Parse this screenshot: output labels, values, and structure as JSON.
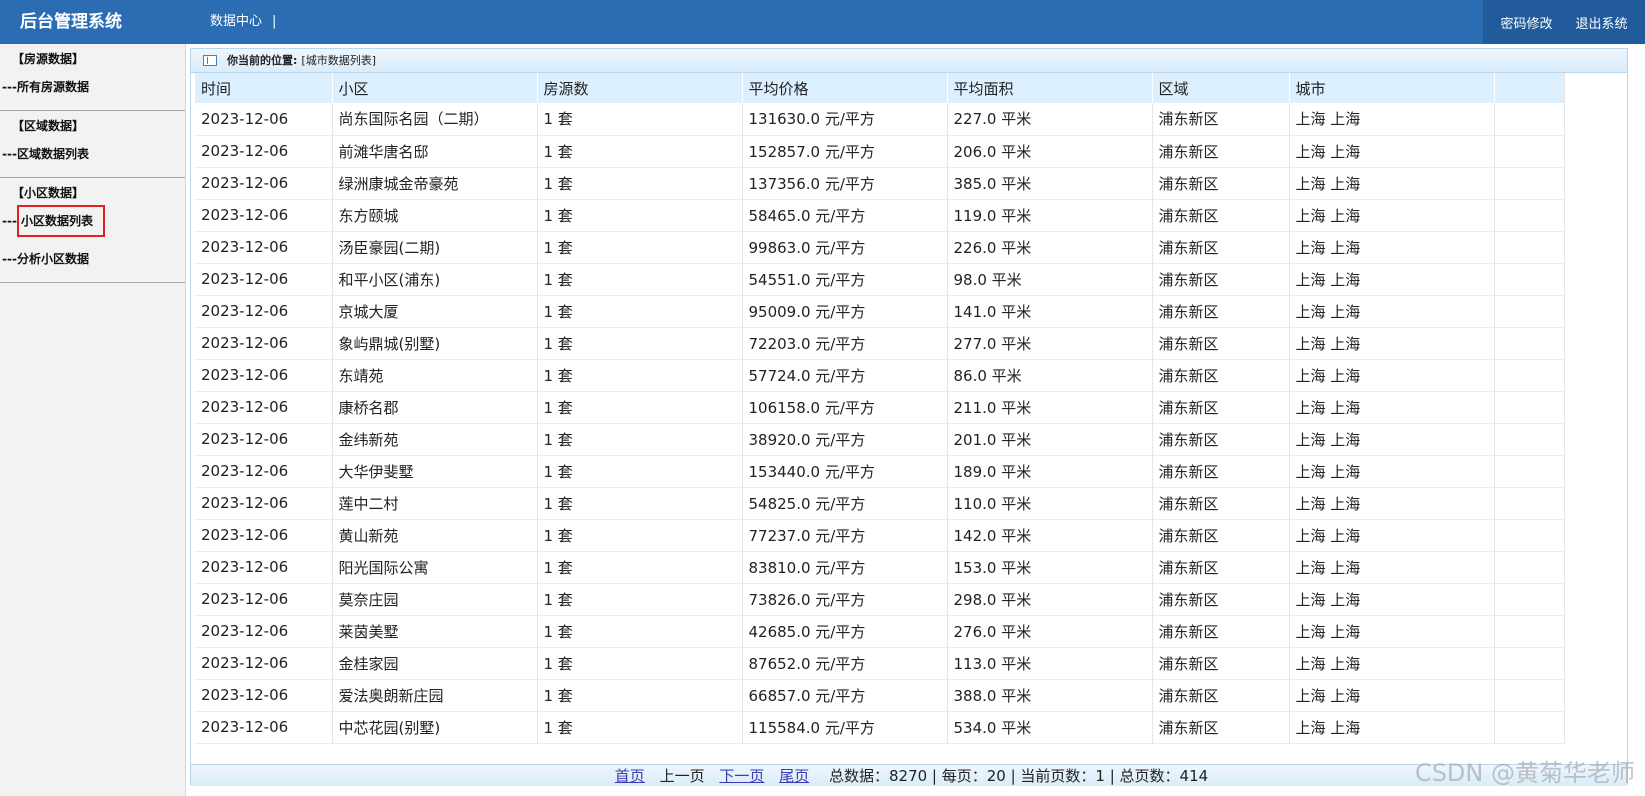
{
  "header": {
    "brand": "后台管理系统",
    "nav_label": "数据中心",
    "nav_sep": "|",
    "change_password": "密码修改",
    "logout": "退出系统"
  },
  "sidebar": {
    "groups": [
      {
        "title": "【房源数据】",
        "items": [
          "---所有房源数据"
        ]
      },
      {
        "title": "【区域数据】",
        "items": [
          "---区域数据列表"
        ]
      },
      {
        "title": "【小区数据】",
        "items": [
          "---",
          "小区数据列表",
          "---分析小区数据"
        ]
      }
    ],
    "active_item": "小区数据列表"
  },
  "location": {
    "label": "你当前的位置:",
    "value": "[城市数据列表]"
  },
  "table": {
    "headers": [
      "时间",
      "小区",
      "房源数",
      "平均价格",
      "平均面积",
      "区域",
      "城市"
    ],
    "rows": [
      [
        "2023-12-06",
        "尚东国际名园（二期）",
        "1 套",
        "131630.0 元/平方",
        "227.0 平米",
        "浦东新区",
        "上海 上海"
      ],
      [
        "2023-12-06",
        "前滩华唐名邸",
        "1 套",
        "152857.0 元/平方",
        "206.0 平米",
        "浦东新区",
        "上海 上海"
      ],
      [
        "2023-12-06",
        "绿洲康城金帝豪苑",
        "1 套",
        "137356.0 元/平方",
        "385.0 平米",
        "浦东新区",
        "上海 上海"
      ],
      [
        "2023-12-06",
        "东方颐城",
        "1 套",
        "58465.0 元/平方",
        "119.0 平米",
        "浦东新区",
        "上海 上海"
      ],
      [
        "2023-12-06",
        "汤臣豪园(二期)",
        "1 套",
        "99863.0 元/平方",
        "226.0 平米",
        "浦东新区",
        "上海 上海"
      ],
      [
        "2023-12-06",
        "和平小区(浦东)",
        "1 套",
        "54551.0 元/平方",
        "98.0 平米",
        "浦东新区",
        "上海 上海"
      ],
      [
        "2023-12-06",
        "京城大厦",
        "1 套",
        "95009.0 元/平方",
        "141.0 平米",
        "浦东新区",
        "上海 上海"
      ],
      [
        "2023-12-06",
        "象屿鼎城(别墅)",
        "1 套",
        "72203.0 元/平方",
        "277.0 平米",
        "浦东新区",
        "上海 上海"
      ],
      [
        "2023-12-06",
        "东靖苑",
        "1 套",
        "57724.0 元/平方",
        "86.0 平米",
        "浦东新区",
        "上海 上海"
      ],
      [
        "2023-12-06",
        "康桥名郡",
        "1 套",
        "106158.0 元/平方",
        "211.0 平米",
        "浦东新区",
        "上海 上海"
      ],
      [
        "2023-12-06",
        "金纬新苑",
        "1 套",
        "38920.0 元/平方",
        "201.0 平米",
        "浦东新区",
        "上海 上海"
      ],
      [
        "2023-12-06",
        "大华伊斐墅",
        "1 套",
        "153440.0 元/平方",
        "189.0 平米",
        "浦东新区",
        "上海 上海"
      ],
      [
        "2023-12-06",
        "莲中二村",
        "1 套",
        "54825.0 元/平方",
        "110.0 平米",
        "浦东新区",
        "上海 上海"
      ],
      [
        "2023-12-06",
        "黄山新苑",
        "1 套",
        "77237.0 元/平方",
        "142.0 平米",
        "浦东新区",
        "上海 上海"
      ],
      [
        "2023-12-06",
        "阳光国际公寓",
        "1 套",
        "83810.0 元/平方",
        "153.0 平米",
        "浦东新区",
        "上海 上海"
      ],
      [
        "2023-12-06",
        "莫奈庄园",
        "1 套",
        "73826.0 元/平方",
        "298.0 平米",
        "浦东新区",
        "上海 上海"
      ],
      [
        "2023-12-06",
        "莱茵美墅",
        "1 套",
        "42685.0 元/平方",
        "276.0 平米",
        "浦东新区",
        "上海 上海"
      ],
      [
        "2023-12-06",
        "金桂家园",
        "1 套",
        "87652.0 元/平方",
        "113.0 平米",
        "浦东新区",
        "上海 上海"
      ],
      [
        "2023-12-06",
        "爱法奥朗新庄园",
        "1 套",
        "66857.0 元/平方",
        "388.0 平米",
        "浦东新区",
        "上海 上海"
      ],
      [
        "2023-12-06",
        "中芯花园(别墅)",
        "1 套",
        "115584.0 元/平方",
        "534.0 平米",
        "浦东新区",
        "上海 上海"
      ]
    ]
  },
  "pager": {
    "first": "首页",
    "prev": "上一页",
    "next": "下一页",
    "last": "尾页",
    "stats": "总数据：8270 | 每页：20 | 当前页数：1 | 总页数：414"
  },
  "watermark": "CSDN @黄菊华老师"
}
